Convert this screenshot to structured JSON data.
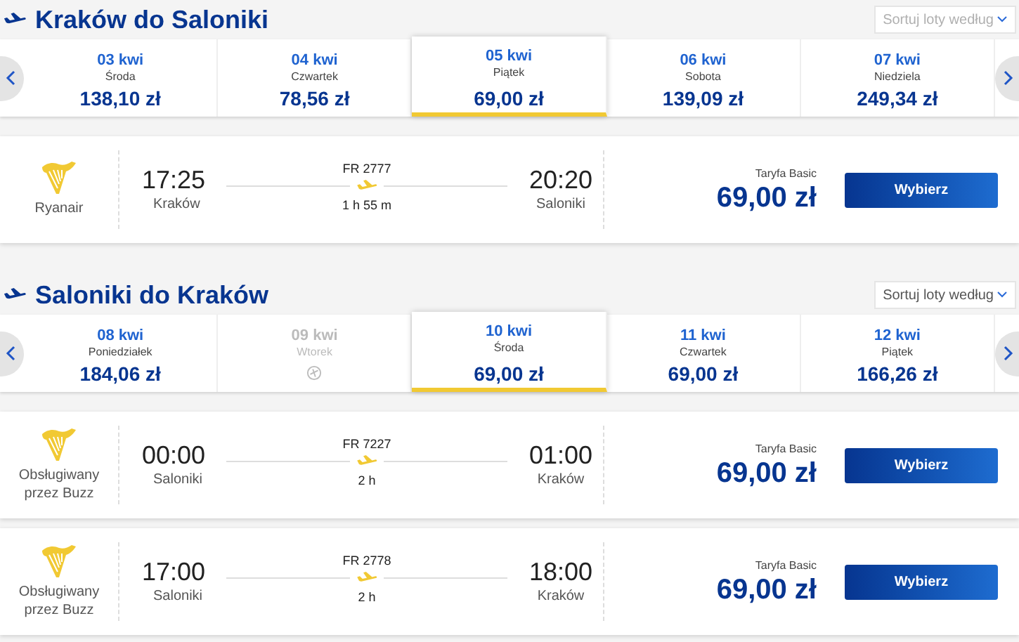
{
  "sections": [
    {
      "title": "Kraków do Saloniki",
      "sort": {
        "placeholder": "Sortuj loty według",
        "disabled": true
      },
      "dates": [
        {
          "date": "03 kwi",
          "day": "Środa",
          "price": "138,10 zł",
          "selected": false,
          "available": true
        },
        {
          "date": "04 kwi",
          "day": "Czwartek",
          "price": "78,56 zł",
          "selected": false,
          "available": true
        },
        {
          "date": "05 kwi",
          "day": "Piątek",
          "price": "69,00 zł",
          "selected": true,
          "available": true
        },
        {
          "date": "06 kwi",
          "day": "Sobota",
          "price": "139,09 zł",
          "selected": false,
          "available": true
        },
        {
          "date": "07 kwi",
          "day": "Niedziela",
          "price": "249,34 zł",
          "selected": false,
          "available": true
        }
      ],
      "flights": [
        {
          "operator": "Ryanair",
          "dep_time": "17:25",
          "dep_city": "Kraków",
          "number": "FR 2777",
          "duration": "1 h 55 m",
          "arr_time": "20:20",
          "arr_city": "Saloniki",
          "fare": "Taryfa Basic",
          "price": "69,00 zł",
          "button": "Wybierz"
        }
      ]
    },
    {
      "title": "Saloniki do Kraków",
      "sort": {
        "placeholder": "Sortuj loty według",
        "disabled": false
      },
      "dates": [
        {
          "date": "08 kwi",
          "day": "Poniedziałek",
          "price": "184,06 zł",
          "selected": false,
          "available": true
        },
        {
          "date": "09 kwi",
          "day": "Wtorek",
          "selected": false,
          "available": false
        },
        {
          "date": "10 kwi",
          "day": "Środa",
          "price": "69,00 zł",
          "selected": true,
          "available": true
        },
        {
          "date": "11 kwi",
          "day": "Czwartek",
          "price": "69,00 zł",
          "selected": false,
          "available": true
        },
        {
          "date": "12 kwi",
          "day": "Piątek",
          "price": "166,26 zł",
          "selected": false,
          "available": true
        }
      ],
      "flights": [
        {
          "operator": "Obsługiwany przez Buzz",
          "dep_time": "00:00",
          "dep_city": "Saloniki",
          "number": "FR 7227",
          "duration": "2 h",
          "arr_time": "01:00",
          "arr_city": "Kraków",
          "fare": "Taryfa Basic",
          "price": "69,00 zł",
          "button": "Wybierz"
        },
        {
          "operator": "Obsługiwany przez Buzz",
          "dep_time": "17:00",
          "dep_city": "Saloniki",
          "number": "FR 2778",
          "duration": "2 h",
          "arr_time": "18:00",
          "arr_city": "Kraków",
          "fare": "Taryfa Basic",
          "price": "69,00 zł",
          "button": "Wybierz"
        }
      ]
    }
  ]
}
